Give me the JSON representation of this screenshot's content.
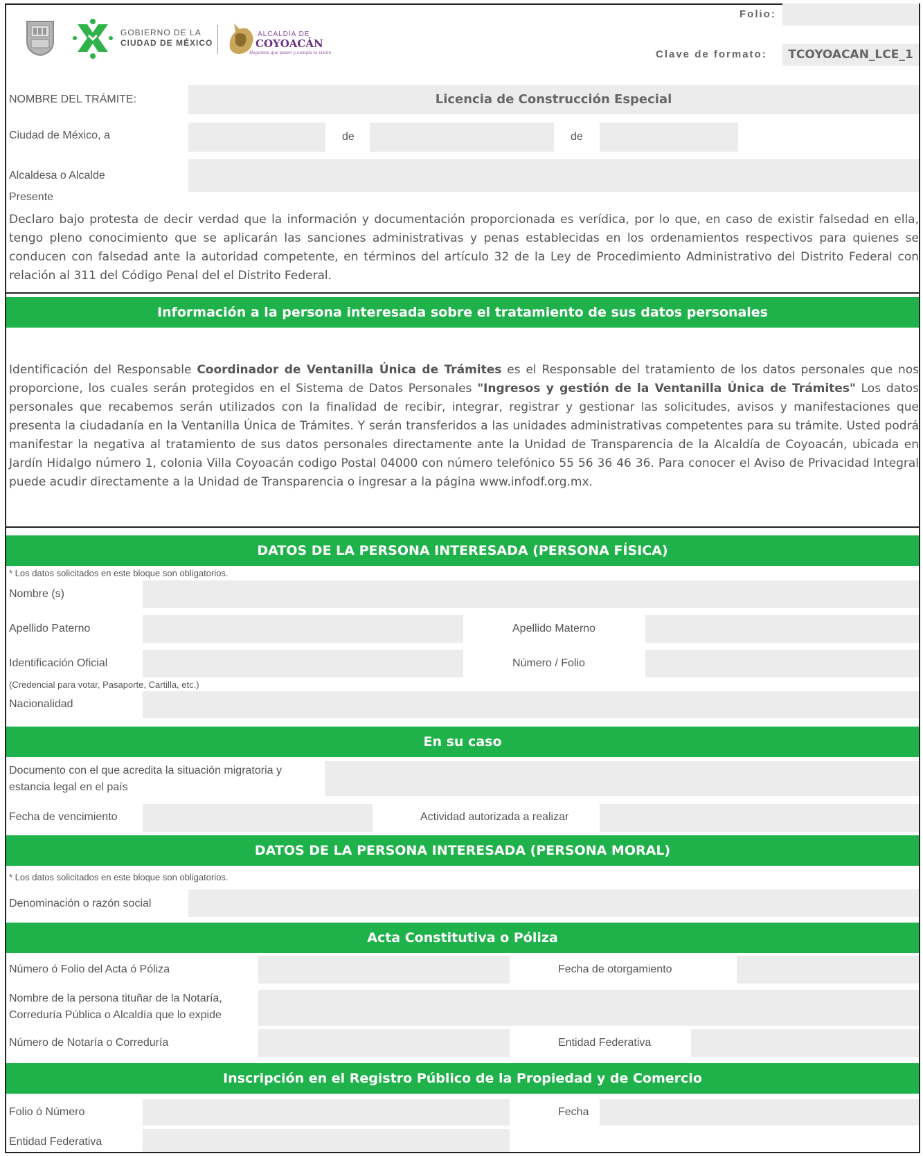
{
  "header": {
    "govt_line1": "GOBIERNO DE LA",
    "govt_line2": "CIUDAD DE MÉXICO",
    "alcaldia_small": "ALCALDÍA DE",
    "alcaldia_name": "COYOACÁN",
    "alcaldia_tagline": "Hagamos que pasen y cumpla la visión",
    "folio_label": "Folio:",
    "folio_value": "",
    "clave_label": "Clave de formato:",
    "clave_value": "TCOYOACAN_LCE_1"
  },
  "intro": {
    "tramite_label": "NOMBRE DEL TRÁMITE:",
    "tramite_value": "Licencia de Construcción Especial",
    "ciudad_label": "Ciudad de México, a",
    "de1": "de",
    "de2": "de",
    "alcalde_label": "Alcaldesa o Alcalde",
    "presente_label": "Presente",
    "declaration": "Declaro bajo protesta de decir verdad que la información y documentación proporcionada es verídica, por lo que, en caso de existir falsedad en ella, tengo pleno conocimiento que se aplicarán las sanciones administrativas y penas establecidas en los ordenamientos respectivos para quienes se conducen con falsedad ante la autoridad competente, en términos del artículo 32 de la Ley de Procedimiento Administrativo del Distrito Federal con relación al 311 del Código Penal del el Distrito Federal."
  },
  "privacy": {
    "title": "Información a la persona interesada sobre el tratamiento de sus datos personales",
    "p1": "Identificación del Responsable ",
    "b1": "Coordinador de Ventanilla Única de Trámites",
    "p2": " es el Responsable del tratamiento de los datos personales que nos proporcione, los cuales serán protegidos en el Sistema de Datos Personales ",
    "b2": "\"Ingresos y gestión de la Ventanilla Única de Trámites\"",
    "p3": " Los datos personales que recabemos serán utilizados con la finalidad de recibir, integrar, registrar y gestionar las solicitudes, avisos y manifestaciones que presenta la ciudadanía en la Ventanilla Única de Trámites. Y serán transferidos a las unidades administrativas competentes para su trámite. Usted podrá manifestar la negativa al tratamiento de sus datos personales directamente ante la Unidad de Transparencia de la Alcaldía de Coyoacán, ubicada en Jardín Hidalgo número 1, colonia Villa Coyoacán codigo Postal 04000 con número telefónico 55 56 36 46 36. Para conocer el Aviso de Privacidad Integral puede acudir directamente a la Unidad de Transparencia o ingresar a la página www.infodf.org.mx."
  },
  "fisica": {
    "title": "DATOS DE LA PERSONA INTERESADA (PERSONA FÍSICA)",
    "note": "* Los datos solicitados en este bloque son obligatorios.",
    "nombre": "Nombre (s)",
    "apellido_paterno": "Apellido Paterno",
    "apellido_materno": "Apellido Materno",
    "identificacion": "Identificación Oficial",
    "numero_folio": "Número / Folio",
    "identificacion_note": "(Credencial para votar, Pasaporte, Cartilla, etc.)",
    "nacionalidad": "Nacionalidad"
  },
  "en_su_caso": {
    "title": "En su caso",
    "documento_line1": "Documento con el que acredita la situación migratoria y",
    "documento_line2": "estancia legal en el país",
    "fecha_vencimiento": "Fecha de vencimiento",
    "actividad": "Actividad autorizada a realizar"
  },
  "moral": {
    "title": "DATOS DE LA PERSONA INTERESADA (PERSONA MORAL)",
    "note": "* Los datos solicitados en este bloque son obligatorios.",
    "denominacion": "Denominación o razón social"
  },
  "acta": {
    "title": "Acta Constitutiva o Póliza",
    "numero_folio": "Número ó Folio del Acta ó Póliza",
    "fecha_otorgamiento": "Fecha de otorgamiento",
    "nombre_line1": "Nombre de la persona tituñar de la Notaría,",
    "nombre_line2": "Correduría Pública o Alcaldía que lo expide",
    "numero_notaria": "Número de Notaría o Correduría",
    "entidad": "Entidad Federativa"
  },
  "registro": {
    "title": "Inscripción en el Registro Público de la Propiedad y de Comercio",
    "folio": "Folio ó Número",
    "fecha": "Fecha",
    "entidad": "Entidad Federativa"
  },
  "colors": {
    "green": "#1fb14a",
    "field": "#ececec"
  }
}
